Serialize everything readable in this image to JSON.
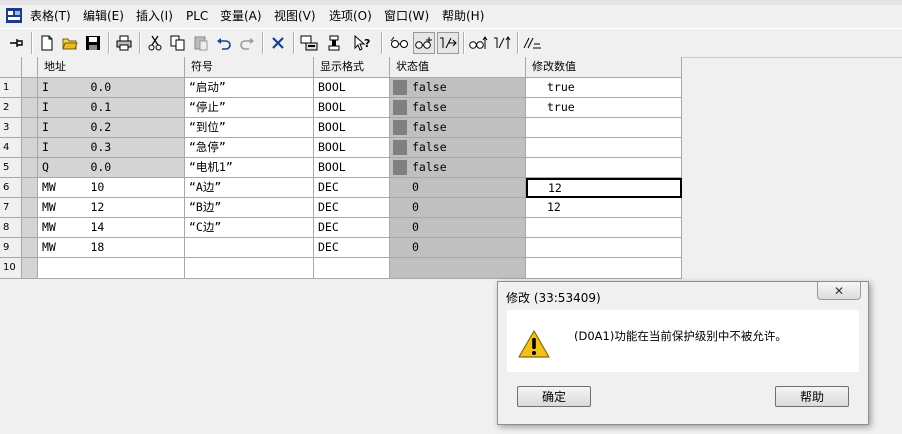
{
  "menubar": {
    "items": [
      "表格(T)",
      "编辑(E)",
      "插入(I)",
      "PLC",
      "变量(A)",
      "视图(V)",
      "选项(O)",
      "窗口(W)",
      "帮助(H)"
    ]
  },
  "toolbar": {
    "buttons": [
      "pin-icon",
      "new-file-icon",
      "open-folder-icon",
      "save-icon",
      "print-icon",
      "cut-icon",
      "copy-icon",
      "paste-icon",
      "undo-icon",
      "redo-icon",
      "delete-icon",
      "plc-monitor-icon",
      "trigger-icon",
      "help-pointer-icon",
      "glasses-icon",
      "glasses-plus-icon",
      "modify-variable-icon",
      "glasses-arrow-icon",
      "modify-arrow-icon",
      "force-icon"
    ]
  },
  "table": {
    "headers": [
      "地址",
      "符号",
      "显示格式",
      "状态值",
      "修改数值"
    ],
    "rows": [
      {
        "num": "1",
        "address": "I      0.0",
        "symbol": "“启动”",
        "format": "BOOL",
        "status": "false",
        "modify": "true"
      },
      {
        "num": "2",
        "address": "I      0.1",
        "symbol": "“停止”",
        "format": "BOOL",
        "status": "false",
        "modify": "true"
      },
      {
        "num": "3",
        "address": "I      0.2",
        "symbol": "“到位”",
        "format": "BOOL",
        "status": "false",
        "modify": ""
      },
      {
        "num": "4",
        "address": "I      0.3",
        "symbol": "“急停”",
        "format": "BOOL",
        "status": "false",
        "modify": ""
      },
      {
        "num": "5",
        "address": "Q      0.0",
        "symbol": "“电机1”",
        "format": "BOOL",
        "status": "false",
        "modify": ""
      },
      {
        "num": "6",
        "address": "MW     10",
        "symbol": "“A边”",
        "format": "DEC",
        "status": "0",
        "modify": "12"
      },
      {
        "num": "7",
        "address": "MW     12",
        "symbol": "“B边”",
        "format": "DEC",
        "status": "0",
        "modify": "12"
      },
      {
        "num": "8",
        "address": "MW     14",
        "symbol": "“C边”",
        "format": "DEC",
        "status": "0",
        "modify": ""
      },
      {
        "num": "9",
        "address": "MW     18",
        "symbol": "",
        "format": "DEC",
        "status": "0",
        "modify": ""
      },
      {
        "num": "10",
        "address": "",
        "symbol": "",
        "format": "",
        "status": "",
        "modify": ""
      }
    ]
  },
  "dialog": {
    "title": "修改 (33:53409)",
    "message": "(D0A1)功能在当前保护级别中不被允许。",
    "ok_label": "确定",
    "help_label": "帮助",
    "close_glyph": "✕"
  },
  "colors": {
    "status_column": "#c0c0c0",
    "selected_row": "#d4d4d4",
    "bool_swatch": "#808080"
  }
}
